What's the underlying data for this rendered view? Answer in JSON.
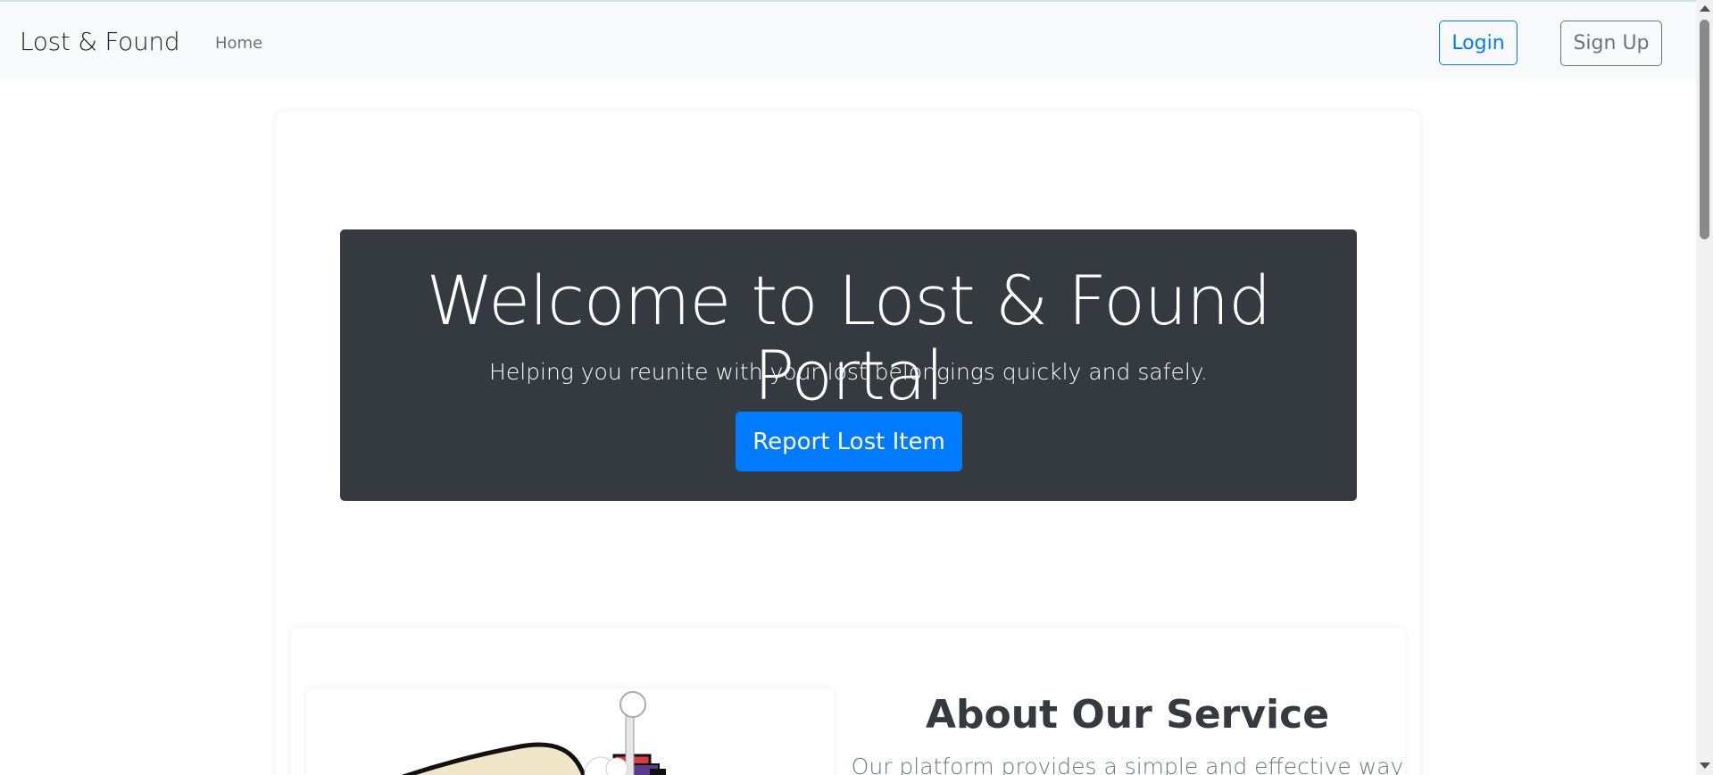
{
  "navbar": {
    "brand": "Lost & Found",
    "links": [
      {
        "label": "Home"
      }
    ],
    "login_label": "Login",
    "signup_label": "Sign Up"
  },
  "hero": {
    "title": "Welcome to Lost & Found Portal",
    "subtitle": "Helping you reunite with your lost belongings quickly and safely.",
    "cta_label": "Report Lost Item"
  },
  "about": {
    "title": "About Our Service",
    "text": "Our platform provides a simple and effective way"
  },
  "colors": {
    "primary": "#007bff",
    "secondary": "#6c757d",
    "dark": "#343a40",
    "navbar_bg": "#f8f9fa"
  },
  "icons": {
    "scroll_up": "triangle-up-icon",
    "scroll_down": "triangle-down-icon"
  }
}
